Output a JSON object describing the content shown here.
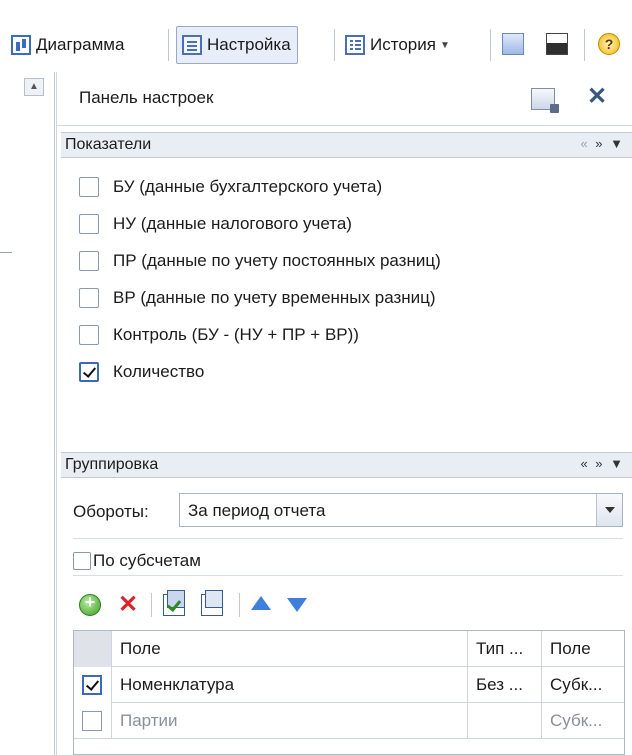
{
  "toolbar": {
    "diagram_label": "Диаграмма",
    "settings_label": "Настройка",
    "history_label": "История"
  },
  "panel": {
    "title": "Панель настроек"
  },
  "indicators": {
    "header": "Показатели",
    "items": [
      {
        "label": "БУ (данные бухгалтерского учета)",
        "checked": false
      },
      {
        "label": "НУ (данные налогового учета)",
        "checked": false
      },
      {
        "label": "ПР (данные по учету постоянных разниц)",
        "checked": false
      },
      {
        "label": "ВР (данные по учету временных разниц)",
        "checked": false
      },
      {
        "label": "Контроль (БУ - (НУ + ПР + ВР))",
        "checked": false
      },
      {
        "label": "Количество",
        "checked": true
      }
    ]
  },
  "grouping": {
    "header": "Группировка",
    "turnover_label": "Обороты:",
    "turnover_value": "За период отчета",
    "subaccounts_label": "По субсчетам",
    "subaccounts_checked": false,
    "table": {
      "columns": [
        "Поле",
        "Тип ...",
        "Поле"
      ],
      "rows": [
        {
          "checked": true,
          "field": "Номенклатура",
          "type": "Без ...",
          "field2": "Субк..."
        },
        {
          "checked": false,
          "field": "Партии",
          "type": "",
          "field2": "Субк..."
        }
      ]
    }
  },
  "icons": {
    "diagram": "chart-icon",
    "settings": "settings-panel-icon",
    "history": "history-list-icon",
    "export": "export-icon",
    "save": "save-icon",
    "help": "help-icon",
    "close": "close-icon",
    "add": "add-icon",
    "delete": "delete-icon",
    "check_all": "check-all-icon",
    "uncheck_all": "uncheck-all-icon",
    "move_up": "arrow-up-icon",
    "move_down": "arrow-down-icon"
  }
}
